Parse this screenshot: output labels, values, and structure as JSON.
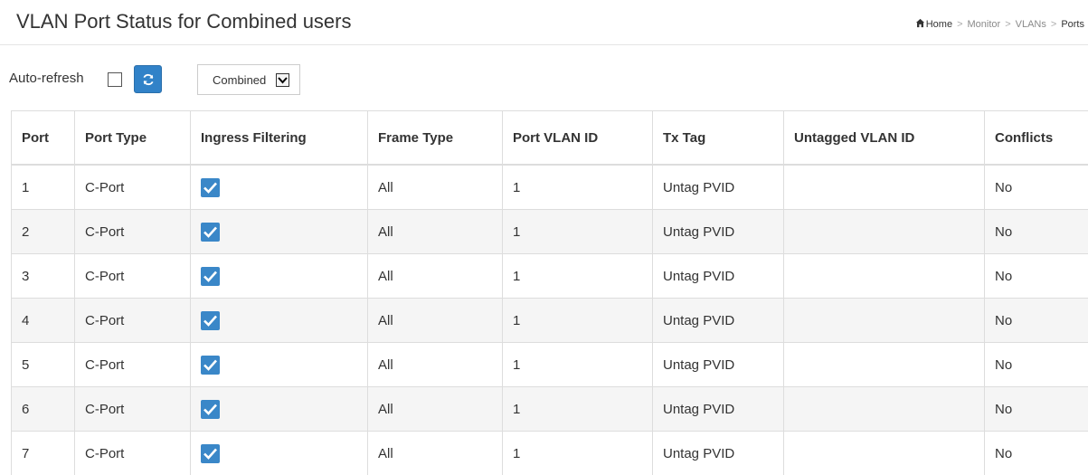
{
  "header": {
    "title": "VLAN Port Status for Combined users",
    "breadcrumb": [
      "Home",
      "Monitor",
      "VLANs",
      "Ports"
    ],
    "breadcrumb_sep": ">"
  },
  "controls": {
    "auto_refresh_label": "Auto-refresh",
    "auto_refresh_checked": false,
    "user_select_value": "Combined"
  },
  "colors": {
    "accent": "#3182c8",
    "checkbox_checked": "#3a87c8",
    "row_alt": "#f5f5f5"
  },
  "table": {
    "columns": [
      "Port",
      "Port Type",
      "Ingress Filtering",
      "Frame Type",
      "Port VLAN ID",
      "Tx Tag",
      "Untagged VLAN ID",
      "Conflicts"
    ],
    "rows": [
      {
        "port": "1",
        "port_type": "C-Port",
        "ingress_filtering": true,
        "frame_type": "All",
        "port_vlan_id": "1",
        "tx_tag": "Untag PVID",
        "untagged_vlan_id": "",
        "conflicts": "No"
      },
      {
        "port": "2",
        "port_type": "C-Port",
        "ingress_filtering": true,
        "frame_type": "All",
        "port_vlan_id": "1",
        "tx_tag": "Untag PVID",
        "untagged_vlan_id": "",
        "conflicts": "No"
      },
      {
        "port": "3",
        "port_type": "C-Port",
        "ingress_filtering": true,
        "frame_type": "All",
        "port_vlan_id": "1",
        "tx_tag": "Untag PVID",
        "untagged_vlan_id": "",
        "conflicts": "No"
      },
      {
        "port": "4",
        "port_type": "C-Port",
        "ingress_filtering": true,
        "frame_type": "All",
        "port_vlan_id": "1",
        "tx_tag": "Untag PVID",
        "untagged_vlan_id": "",
        "conflicts": "No"
      },
      {
        "port": "5",
        "port_type": "C-Port",
        "ingress_filtering": true,
        "frame_type": "All",
        "port_vlan_id": "1",
        "tx_tag": "Untag PVID",
        "untagged_vlan_id": "",
        "conflicts": "No"
      },
      {
        "port": "6",
        "port_type": "C-Port",
        "ingress_filtering": true,
        "frame_type": "All",
        "port_vlan_id": "1",
        "tx_tag": "Untag PVID",
        "untagged_vlan_id": "",
        "conflicts": "No"
      },
      {
        "port": "7",
        "port_type": "C-Port",
        "ingress_filtering": true,
        "frame_type": "All",
        "port_vlan_id": "1",
        "tx_tag": "Untag PVID",
        "untagged_vlan_id": "",
        "conflicts": "No"
      }
    ]
  }
}
